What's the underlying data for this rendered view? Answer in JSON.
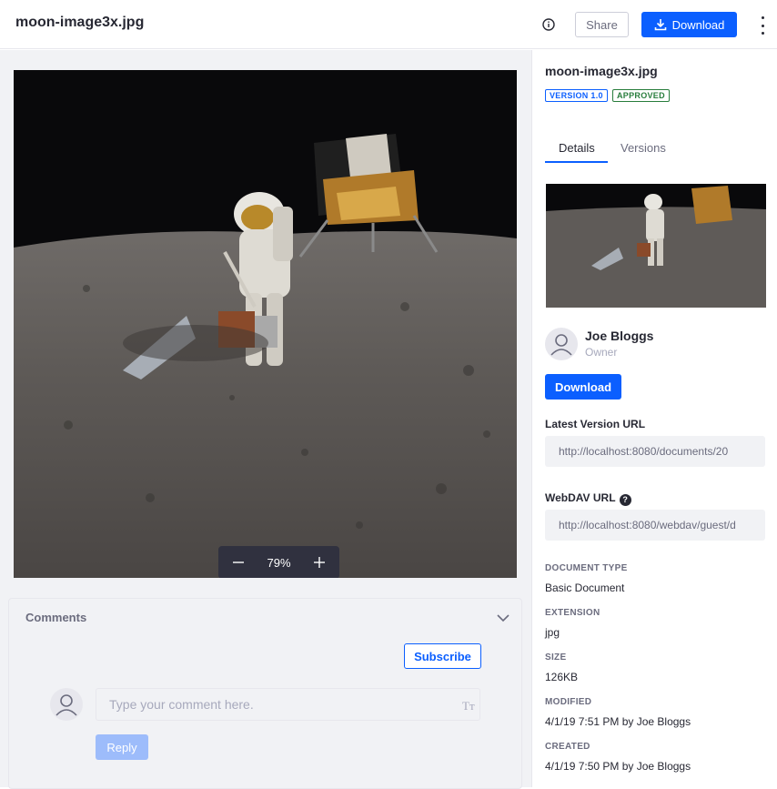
{
  "header": {
    "title": "moon-image3x.jpg",
    "share_label": "Share",
    "download_label": "Download"
  },
  "preview": {
    "zoom_value": "79%"
  },
  "comments": {
    "title": "Comments",
    "subscribe_label": "Subscribe",
    "input_placeholder": "Type your comment here.",
    "format_icon_text": "Tт",
    "reply_label": "Reply"
  },
  "sidebar": {
    "title": "moon-image3x.jpg",
    "version_badge": "VERSION 1.0",
    "status_badge": "APPROVED",
    "tabs": [
      {
        "label": "Details"
      },
      {
        "label": "Versions"
      }
    ],
    "owner": {
      "name": "Joe Bloggs",
      "role": "Owner"
    },
    "download_label": "Download",
    "latest_version_url_label": "Latest Version URL",
    "latest_version_url": "http://localhost:8080/documents/20",
    "webdav_url_label": "WebDAV URL",
    "webdav_url": "http://localhost:8080/webdav/guest/d",
    "metadata": [
      {
        "key": "DOCUMENT TYPE",
        "value": "Basic Document"
      },
      {
        "key": "EXTENSION",
        "value": "jpg"
      },
      {
        "key": "SIZE",
        "value": "126KB"
      },
      {
        "key": "MODIFIED",
        "value": "4/1/19 7:51 PM by Joe Bloggs"
      },
      {
        "key": "CREATED",
        "value": "4/1/19 7:50 PM by Joe Bloggs"
      }
    ]
  },
  "colors": {
    "accent": "#0b5fff",
    "approved": "#287d3c",
    "panel_bg": "#f1f2f5"
  }
}
